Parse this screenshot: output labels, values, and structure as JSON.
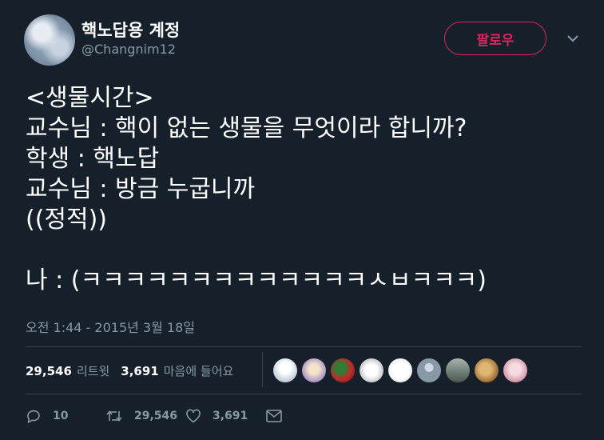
{
  "header": {
    "display_name": "핵노답용 계정",
    "handle": "@Changnim12",
    "follow_label": "팔로우"
  },
  "tweet": {
    "text": "<생물시간>\n교수님 : 핵이 없는 생물을 무엇이라 합니까?\n학생 : 핵노답\n교수님 : 방금 누굽니까\n((정적))\n\n나 : (ㅋㅋㅋㅋㅋㅋㅋㅋㅋㅋㅋㅋㅋㅅㅂㅋㅋㅋ)",
    "timestamp": "오전 1:44 - 2015년 3월 18일"
  },
  "stats": {
    "retweets_count": "29,546",
    "retweets_label": "리트윗",
    "likes_count": "3,691",
    "likes_label": "마음에 들어요"
  },
  "liker_avatars": [
    {
      "icon": "avatar-anime-white",
      "color": "#dfe7ee"
    },
    {
      "icon": "avatar-anime-purple",
      "color": "#b9a5c9"
    },
    {
      "icon": "avatar-red-green",
      "color": "#b3352a"
    },
    {
      "icon": "avatar-sketch",
      "color": "#d9d9d9"
    },
    {
      "icon": "avatar-text",
      "color": "#f0f0f0"
    },
    {
      "icon": "avatar-default",
      "color": "#8899a6"
    },
    {
      "icon": "avatar-building",
      "color": "#7f8c84"
    },
    {
      "icon": "avatar-bread",
      "color": "#b08a55"
    },
    {
      "icon": "avatar-pink-anime",
      "color": "#e6b3bf"
    }
  ],
  "actions": {
    "reply_count": "10",
    "retweet_count": "29,546",
    "like_count": "3,691"
  },
  "colors": {
    "background": "#15202b",
    "accent": "#e0245e",
    "muted": "#8899a6",
    "divider": "#38444d"
  }
}
